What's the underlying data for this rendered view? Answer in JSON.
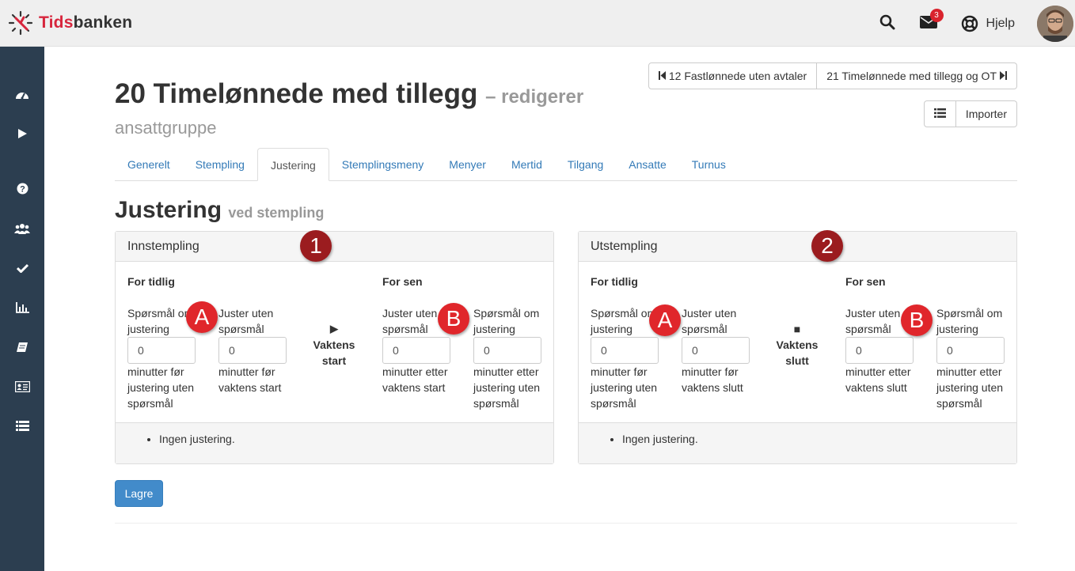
{
  "app": {
    "brand_a": "Tids",
    "brand_b": "banken"
  },
  "topbar": {
    "mail_count": "3",
    "help_label": "Hjelp"
  },
  "sidebar": {
    "items": [
      "dashboard-icon",
      "play-icon",
      "help-icon",
      "users-icon",
      "check-icon",
      "chart-icon",
      "book-icon",
      "id-card-icon",
      "list-icon"
    ]
  },
  "header": {
    "title": "20 Timelønnede med tillegg",
    "title_suffix": "– redigerer",
    "subtitle": "ansattgruppe",
    "prev_label": "12 Fastlønnede uten avtaler",
    "next_label": "21 Timelønnede med tillegg og OT",
    "import_label": "Importer"
  },
  "tabs": [
    "Generelt",
    "Stempling",
    "Justering",
    "Stemplingsmeny",
    "Menyer",
    "Mertid",
    "Tilgang",
    "Ansatte",
    "Turnus"
  ],
  "active_tab": "Justering",
  "section": {
    "title": "Justering",
    "subtitle": "ved stempling"
  },
  "panels": [
    {
      "heading": "Innstempling",
      "marker": "1",
      "early_title": "For tidlig",
      "late_title": "For sen",
      "col1_label": "Spørsmål om justering",
      "col1_value": "0",
      "col1_unit": "minutter før justering uten spørsmål",
      "col2_label": "Juster uten spørsmål",
      "col2_value": "0",
      "col2_unit": "minutter før vaktens start",
      "center_symbol": "▶",
      "center_label": "Vaktens start",
      "col3_label": "Juster uten spørsmål",
      "col3_value": "0",
      "col3_unit": "minutter etter vaktens start",
      "col4_label": "Spørsmål om justering",
      "col4_value": "0",
      "col4_unit": "minutter etter justering uten spørsmål",
      "footer_item": "Ingen justering.",
      "mark_a": "A",
      "mark_b": "B"
    },
    {
      "heading": "Utstempling",
      "marker": "2",
      "early_title": "For tidlig",
      "late_title": "For sen",
      "col1_label": "Spørsmål om justering",
      "col1_value": "0",
      "col1_unit": "minutter før justering uten spørsmål",
      "col2_label": "Juster uten spørsmål",
      "col2_value": "0",
      "col2_unit": "minutter før vaktens slutt",
      "center_symbol": "■",
      "center_label": "Vaktens slutt",
      "col3_label": "Juster uten spørsmål",
      "col3_value": "0",
      "col3_unit": "minutter etter vaktens slutt",
      "col4_label": "Spørsmål om justering",
      "col4_value": "0",
      "col4_unit": "minutter etter justering uten spørsmål",
      "footer_item": "Ingen justering.",
      "mark_a": "A",
      "mark_b": "B"
    }
  ],
  "save_label": "Lagre",
  "colors": {
    "brand_red": "#d7263d",
    "sidebar": "#2c3e50",
    "link": "#337ab7",
    "primary": "#428bca",
    "marker_dark": "#9b1c1f",
    "marker_red": "#e0262b"
  }
}
